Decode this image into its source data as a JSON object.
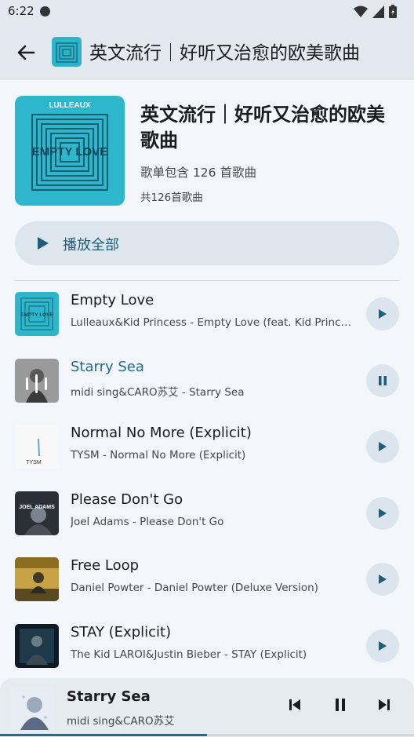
{
  "status_bar": {
    "time": "6:22"
  },
  "app_bar": {
    "title": "英文流行｜好听又治愈的欧美歌曲"
  },
  "header": {
    "title": "英文流行｜好听又治愈的欧美歌曲",
    "description": "歌单包含 126 首歌曲",
    "count": "共126首歌曲",
    "cover_text_top": "LULLEAUX",
    "cover_text_art": "EMPTY LOVE"
  },
  "play_all": {
    "label": "播放全部"
  },
  "songs": [
    {
      "title": "Empty Love",
      "subtitle": "Lulleaux&Kid Princess - Empty Love (feat. Kid Princess)",
      "state": "play",
      "cover_art": "EMPTY LOVE"
    },
    {
      "title": "Starry Sea",
      "subtitle": "midi sing&CARO苏艾 - Starry Sea",
      "state": "pause",
      "active": true
    },
    {
      "title": "Normal No More (Explicit)",
      "subtitle": "TYSM - Normal No More (Explicit)",
      "state": "play",
      "cover_art": "TYSM"
    },
    {
      "title": "Please Don't Go",
      "subtitle": "Joel Adams - Please Don't Go",
      "state": "play",
      "cover_art": "JOEL ADAMS"
    },
    {
      "title": "Free Loop",
      "subtitle": "Daniel Powter - Daniel Powter (Deluxe Version)",
      "state": "play"
    },
    {
      "title": "STAY (Explicit)",
      "subtitle": "The Kid LAROI&Justin Bieber - STAY (Explicit)",
      "state": "play"
    }
  ],
  "mini_player": {
    "title": "Starry Sea",
    "subtitle": "midi sing&CARO苏艾",
    "progress_fraction": 0.5
  },
  "icons": {
    "back": "arrow-left-icon",
    "play": "play-icon",
    "pause": "pause-icon",
    "prev": "skip-previous-icon",
    "next": "skip-next-icon",
    "wifi": "wifi-icon",
    "signal": "signal-icon",
    "battery": "battery-icon"
  },
  "colors": {
    "accent": "#1f6b8d",
    "background": "#f3f6fa",
    "bar": "#e3e8ee",
    "button": "#dce5ee"
  }
}
